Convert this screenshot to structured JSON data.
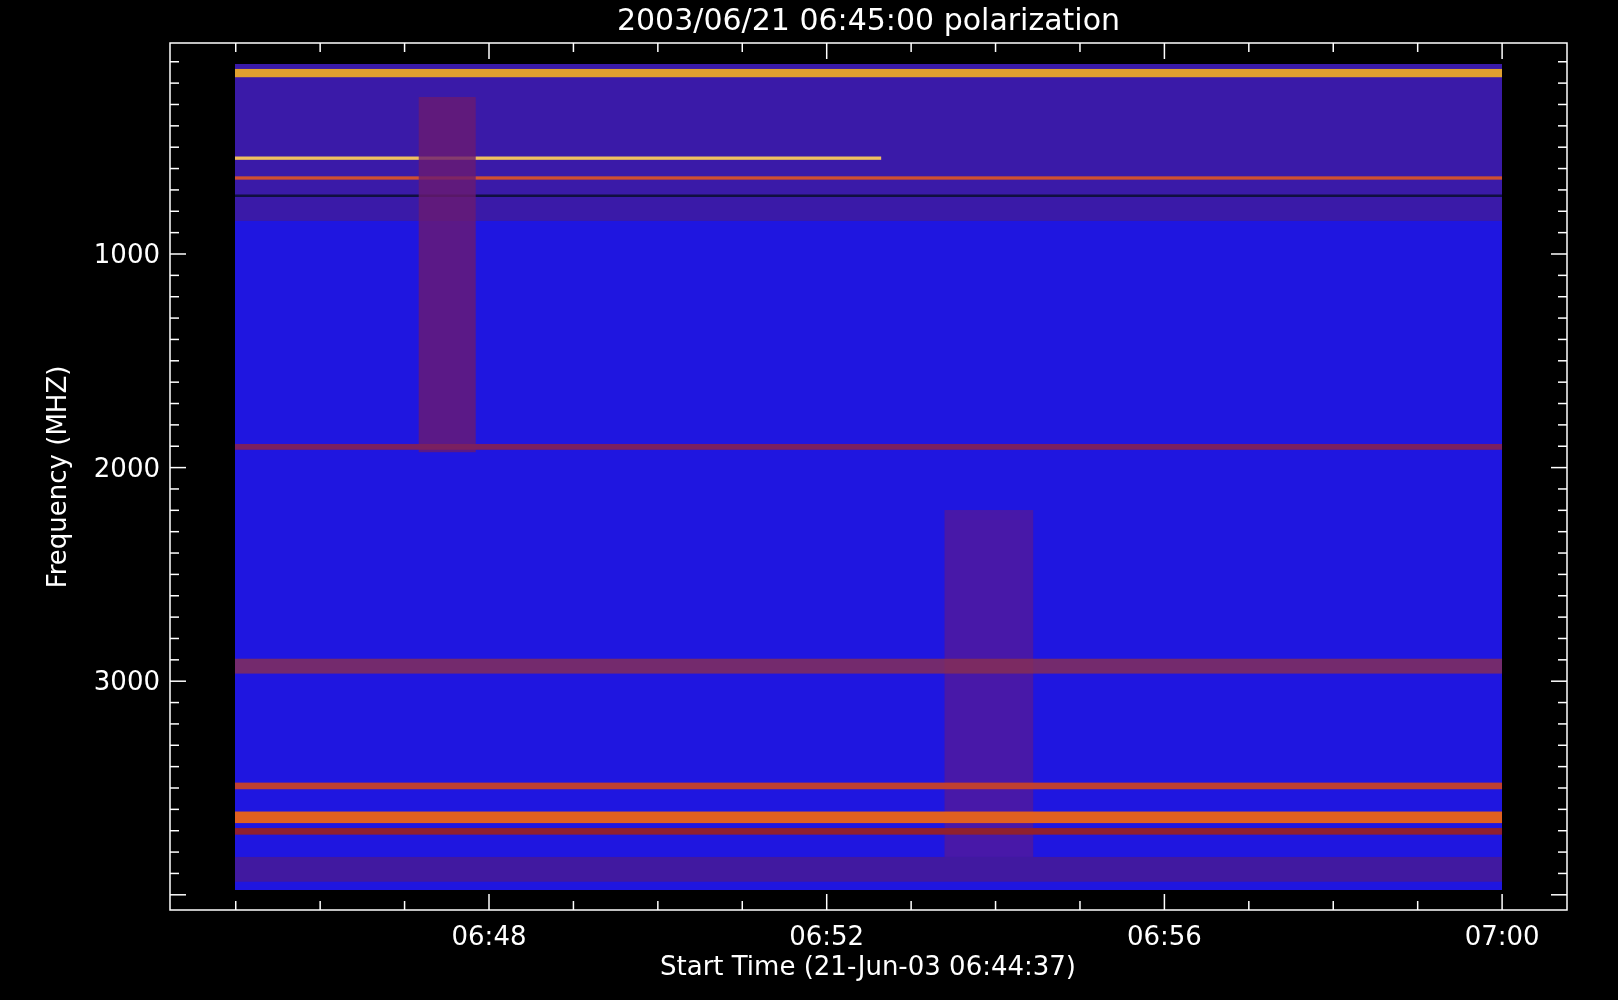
{
  "title": "2003/06/21 06:45:00 polarization",
  "y_axis": {
    "label": "Frequency (MHZ)",
    "ticks": [
      "1000",
      "2000",
      "3000"
    ]
  },
  "x_axis": {
    "label": "Start Time (21-Jun-03 06:44:37)",
    "ticks": [
      "06:48",
      "06:52",
      "06:56",
      "07:00"
    ]
  }
}
